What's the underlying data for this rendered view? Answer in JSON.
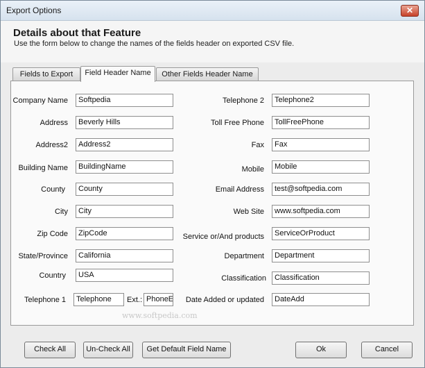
{
  "window": {
    "title": "Export Options",
    "close_glyph": "✕"
  },
  "header": {
    "title": "Details about that  Feature",
    "description": "Use the form below to change the names of the fields header on exported CSV file."
  },
  "tabs": [
    {
      "label": "Fields to Export"
    },
    {
      "label": "Field Header Name"
    },
    {
      "label": "Other Fields Header Name"
    }
  ],
  "form": {
    "left": [
      {
        "label": "Company Name",
        "value": "Softpedia"
      },
      {
        "label": "Address",
        "value": "Beverly Hills"
      },
      {
        "label": "Address2",
        "value": "Address2"
      },
      {
        "label": "Building Name",
        "value": "BuildingName"
      },
      {
        "label": "County",
        "value": "County"
      },
      {
        "label": "City",
        "value": "City"
      },
      {
        "label": "Zip Code",
        "value": "ZipCode"
      },
      {
        "label": "State/Province",
        "value": "California"
      },
      {
        "label": "Country",
        "value": "USA"
      }
    ],
    "telephone1": {
      "label": "Telephone 1",
      "value": "Telephone",
      "ext_label": "Ext.:",
      "ext_value": "PhoneExt"
    },
    "right": [
      {
        "label": "Telephone 2",
        "value": "Telephone2"
      },
      {
        "label": "Toll Free Phone",
        "value": "TollFreePhone"
      },
      {
        "label": "Fax",
        "value": "Fax"
      },
      {
        "label": "Mobile",
        "value": "Mobile"
      },
      {
        "label": "Email Address",
        "value": "test@softpedia.com"
      },
      {
        "label": "Web Site",
        "value": "www.softpedia.com"
      },
      {
        "label": "Service or/And products",
        "value": "ServiceOrProduct"
      },
      {
        "label": "Department",
        "value": "Department"
      },
      {
        "label": "Classification",
        "value": "Classification"
      },
      {
        "label": "Date Added or updated",
        "value": "DateAdd"
      }
    ]
  },
  "watermark": "www.softpedia.com",
  "buttons": {
    "check_all": "Check All",
    "uncheck_all": "Un-Check All",
    "get_default": "Get Default Field Name",
    "ok": "Ok",
    "cancel": "Cancel"
  }
}
